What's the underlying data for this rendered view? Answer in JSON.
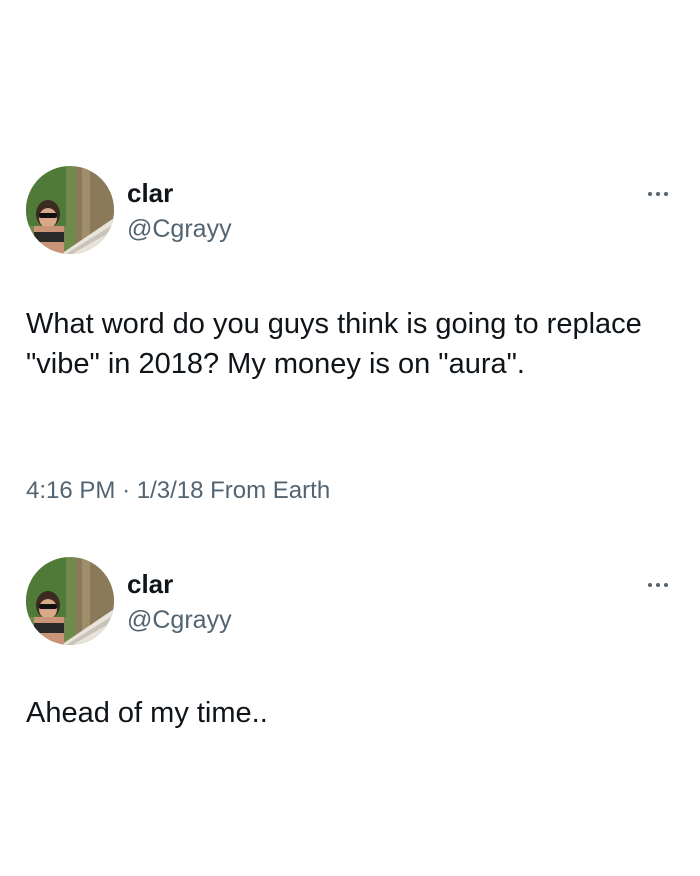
{
  "tweets": [
    {
      "display_name": "clar",
      "handle": "@Cgrayy",
      "text": "What word do you guys think is going to replace \"vibe\" in 2018? My money is on \"aura\".",
      "time": "4:16 PM",
      "separator": "·",
      "date": "1/3/18",
      "location": "From Earth",
      "more_icon": "more-horizontal-icon"
    },
    {
      "display_name": "clar",
      "handle": "@Cgrayy",
      "text": "Ahead of my time..",
      "more_icon": "more-horizontal-icon"
    }
  ],
  "colors": {
    "primary_text": "#0f1419",
    "secondary_text": "#536471",
    "background": "#ffffff"
  }
}
